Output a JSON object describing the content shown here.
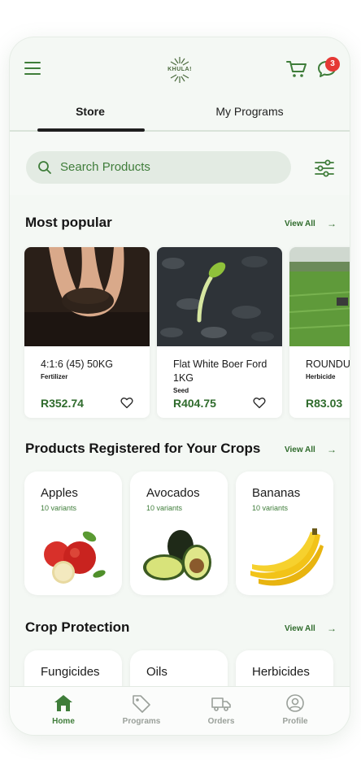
{
  "header": {
    "logo_text": "KHULA!",
    "notification_count": "3"
  },
  "tabs": [
    {
      "label": "Store"
    },
    {
      "label": "My Programs"
    }
  ],
  "search": {
    "placeholder": "Search Products"
  },
  "most_popular": {
    "title": "Most popular",
    "view_all": "View All",
    "products": [
      {
        "name": "4:1:6 (45) 50KG",
        "type": "Fertilizer",
        "price": "R352.74"
      },
      {
        "name": "Flat White Boer Ford 1KG",
        "type": "Seed",
        "price": "R404.75"
      },
      {
        "name": "ROUNDU",
        "type": "Herbicide",
        "price": "R83.03"
      }
    ]
  },
  "registered_crops": {
    "title": "Products Registered for Your Crops",
    "view_all": "View All",
    "crops": [
      {
        "name": "Apples",
        "variants": "10 variants"
      },
      {
        "name": "Avocados",
        "variants": "10 variants"
      },
      {
        "name": "Bananas",
        "variants": "10 variants"
      }
    ]
  },
  "crop_protection": {
    "title": "Crop Protection",
    "view_all": "View All",
    "categories": [
      {
        "name": "Fungicides"
      },
      {
        "name": "Oils"
      },
      {
        "name": "Herbicides"
      }
    ]
  },
  "bottom_nav": [
    {
      "label": "Home"
    },
    {
      "label": "Programs"
    },
    {
      "label": "Orders"
    },
    {
      "label": "Profile"
    }
  ],
  "colors": {
    "primary_green": "#3f7d3a",
    "price_green": "#2f6b2c",
    "badge_red": "#e53935",
    "background": "#f4f8f4"
  }
}
